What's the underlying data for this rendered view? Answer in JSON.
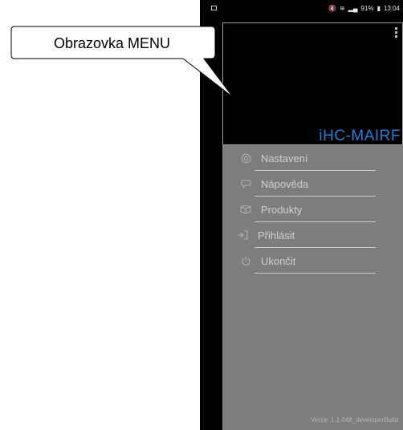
{
  "status_bar": {
    "battery": "91%",
    "time": "13:04"
  },
  "app": {
    "name": "iHC-MAIRF"
  },
  "menu": {
    "items": [
      {
        "label": "Nastavení",
        "icon": "gear-icon"
      },
      {
        "label": "Nápověda",
        "icon": "chat-bubble-icon"
      },
      {
        "label": "Produkty",
        "icon": "box-icon"
      },
      {
        "label": "Přihlásit",
        "icon": "login-icon"
      },
      {
        "label": "Ukončit",
        "icon": "power-icon"
      }
    ]
  },
  "version": "Verze: 1.1.048_developerBuild",
  "callout": {
    "text": "Obrazovka MENU"
  }
}
